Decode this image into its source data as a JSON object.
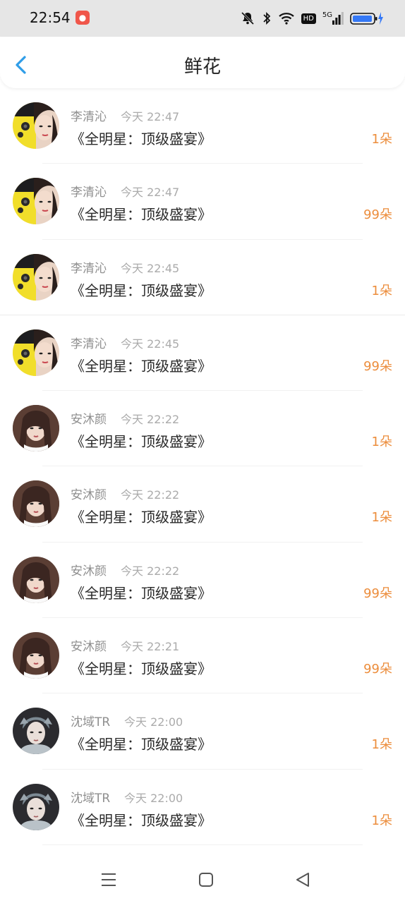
{
  "status_bar": {
    "time": "22:54",
    "app_icon": "red-app-notification-icon",
    "icons": [
      "mute-bell-icon",
      "bluetooth-icon",
      "wifi-icon",
      "hd-icon",
      "5g-signal-icon",
      "battery-charging-icon"
    ],
    "hd_label": "HD",
    "network_label": "5G"
  },
  "header": {
    "title": "鲜花",
    "back_icon": "chevron-left-icon",
    "accent_color": "#2f9de8"
  },
  "count_color": "#ec8d3c",
  "records": [
    {
      "name": "李清沁",
      "time": "今天 22:47",
      "content": "《全明星：顶级盛宴》",
      "count": "1朵",
      "avatar": "portrait-yellow"
    },
    {
      "name": "李清沁",
      "time": "今天 22:47",
      "content": "《全明星：顶级盛宴》",
      "count": "99朵",
      "avatar": "portrait-yellow"
    },
    {
      "name": "李清沁",
      "time": "今天 22:45",
      "content": "《全明星：顶级盛宴》",
      "count": "1朵",
      "avatar": "portrait-yellow"
    },
    {
      "name": "李清沁",
      "time": "今天 22:45",
      "content": "《全明星：顶级盛宴》",
      "count": "99朵",
      "avatar": "portrait-yellow"
    },
    {
      "name": "安沐颜",
      "time": "今天 22:22",
      "content": "《全明星：顶级盛宴》",
      "count": "1朵",
      "avatar": "portrait-brown"
    },
    {
      "name": "安沐颜",
      "time": "今天 22:22",
      "content": "《全明星：顶级盛宴》",
      "count": "1朵",
      "avatar": "portrait-brown"
    },
    {
      "name": "安沐颜",
      "time": "今天 22:22",
      "content": "《全明星：顶级盛宴》",
      "count": "99朵",
      "avatar": "portrait-brown"
    },
    {
      "name": "安沐颜",
      "time": "今天 22:21",
      "content": "《全明星：顶级盛宴》",
      "count": "99朵",
      "avatar": "portrait-brown"
    },
    {
      "name": "沈域TR",
      "time": "今天 22:00",
      "content": "《全明星：顶级盛宴》",
      "count": "1朵",
      "avatar": "portrait-gray"
    },
    {
      "name": "沈域TR",
      "time": "今天 22:00",
      "content": "《全明星：顶级盛宴》",
      "count": "1朵",
      "avatar": "portrait-gray"
    }
  ],
  "bottom_nav": {
    "menu_icon": "menu-lines-icon",
    "home_icon": "home-square-icon",
    "back_icon": "back-triangle-icon"
  }
}
